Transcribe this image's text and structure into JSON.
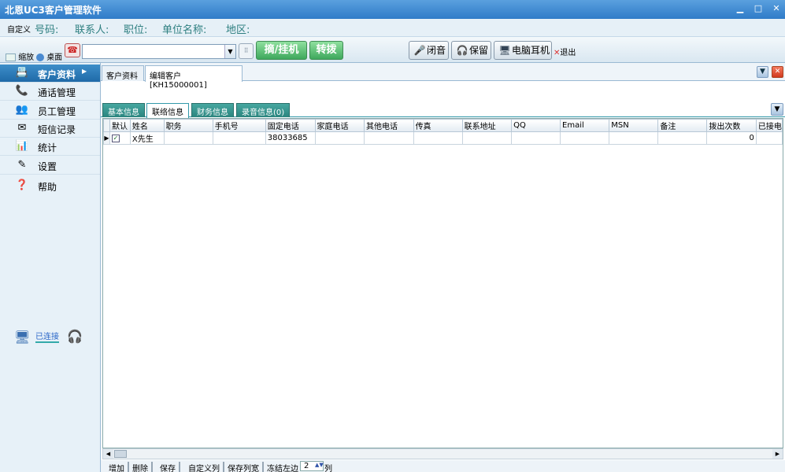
{
  "window": {
    "title": "北恩UC3客户管理软件",
    "minimize": "▁",
    "maximize": "□",
    "close": "✕"
  },
  "infobar": {
    "custom": "自定义",
    "phone": "号码:",
    "contact": "联系人:",
    "position": "职位:",
    "company": "单位名称:",
    "region": "地区:"
  },
  "toolbar": {
    "minimize_label": "缩放",
    "desktop_label": "桌面",
    "phone_number_value": "",
    "pickup_hangup": "摘/挂机",
    "transfer": "转拨",
    "mute": "闭音",
    "hold": "保留",
    "pc_headset": "电脑耳机",
    "exit": "退出"
  },
  "sidebar": {
    "items": [
      {
        "label": "客户资料",
        "icon": "customer-card-icon",
        "active": true
      },
      {
        "label": "通话管理",
        "icon": "call-management-icon"
      },
      {
        "label": "员工管理",
        "icon": "staff-icon"
      },
      {
        "label": "短信记录",
        "icon": "envelope-icon"
      },
      {
        "label": "统计",
        "icon": "bar-chart-icon"
      },
      {
        "label": "设置",
        "icon": "settings-icon"
      },
      {
        "label": "帮助",
        "icon": "help-icon"
      }
    ],
    "connection_status": "已连接"
  },
  "doc_tabs": [
    "客户资料",
    "编辑客户[KH15000001]"
  ],
  "sub_tabs": [
    "基本信息",
    "联络信息",
    "财务信息",
    "录音信息(0)"
  ],
  "grid": {
    "columns": [
      "默认",
      "姓名",
      "职务",
      "手机号",
      "固定电话",
      "家庭电话",
      "其他电话",
      "传真",
      "联系地址",
      "QQ",
      "Email",
      "MSN",
      "备注",
      "拨出次数",
      "已接电"
    ],
    "rows": [
      {
        "default_checked": true,
        "name": "X先生",
        "title": "",
        "mobile": "",
        "landline": "38033685",
        "home": "",
        "other": "",
        "fax": "",
        "address": "",
        "qq": "",
        "email": "",
        "msn": "",
        "note": "",
        "outbound_count": "0",
        "answered": ""
      }
    ]
  },
  "bottom_bar": {
    "add": "增加",
    "delete": "删除",
    "save": "保存",
    "custom_columns": "自定义列",
    "save_widths": "保存列宽",
    "freeze_left": "冻结左边",
    "freeze_value": "2",
    "columns_unit": "列"
  }
}
